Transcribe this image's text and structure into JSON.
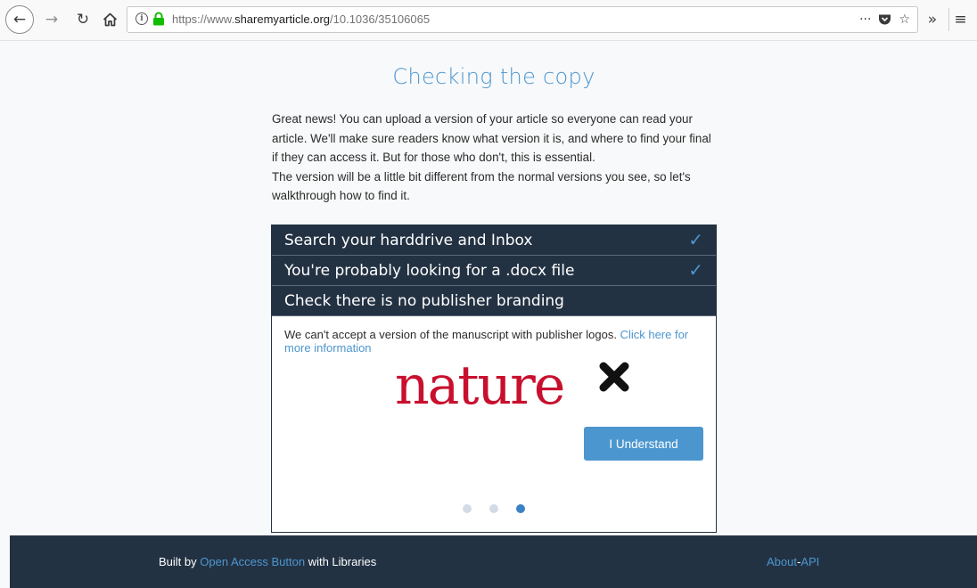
{
  "browser": {
    "url_prefix": "https://www.",
    "url_domain": "sharemyarticle.org",
    "url_path": "/10.1036/35106065",
    "info_symbol": "i",
    "page_actions": "···",
    "overflow": "»",
    "menu": "≡"
  },
  "page": {
    "title": "Checking the copy",
    "intro_1": "Great news! You can upload a version of your article so everyone can read your article. We'll make sure readers know what version it is, and where to find your final if they can access it. But for those who don't, this is essential.",
    "intro_2": "The version will be a little bit different from the normal versions you see, so let's walkthrough how to find it."
  },
  "steps": [
    {
      "label": "Search your harddrive and Inbox",
      "done": true
    },
    {
      "label": "You're probably looking for a .docx file",
      "done": true
    },
    {
      "label": "Check there is no publisher branding",
      "done": false
    }
  ],
  "panel": {
    "text": "We can't accept a version of the manuscript with publisher logos.",
    "link": "Click here for more information",
    "logo_text": "nature",
    "button": "I Understand"
  },
  "pagination": {
    "total": 3,
    "current": 3
  },
  "footer": {
    "built_by": "Built by",
    "oab_link": "Open Access Button",
    "with_libraries": "with Libraries",
    "about": "About",
    "sep": "-",
    "api": "API"
  },
  "colors": {
    "accent": "#4c96cf",
    "navy": "#233243",
    "nature_red": "#c8102e"
  }
}
